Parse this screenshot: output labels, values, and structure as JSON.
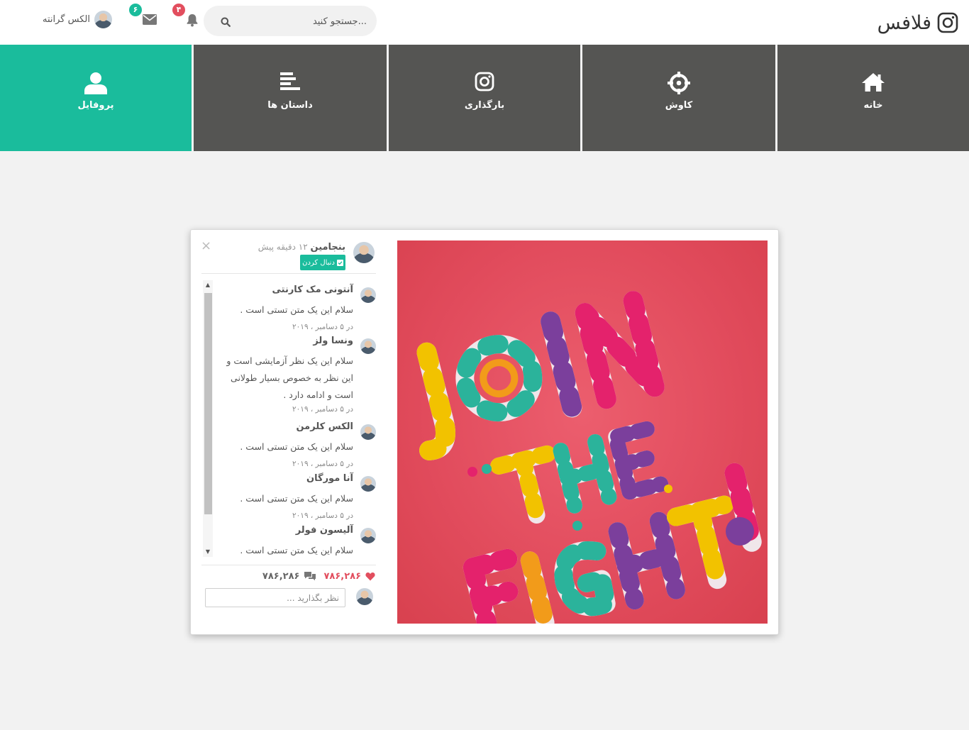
{
  "header": {
    "logo_text": "فلافس",
    "search_placeholder": "جستجو کنید...",
    "notifications_count": "۴",
    "messages_count": "۶",
    "user_name": "الکس گرانته"
  },
  "nav": {
    "tiles": [
      {
        "label": "خانه",
        "icon": "home-icon"
      },
      {
        "label": "کاوش",
        "icon": "crosshair-icon"
      },
      {
        "label": "بارگذاری",
        "icon": "instagram-icon"
      },
      {
        "label": "داستان ها",
        "icon": "align-left-icon"
      },
      {
        "label": "پروفایل",
        "icon": "user-icon"
      }
    ],
    "active": "پروفایل"
  },
  "post": {
    "author": "بنجامین",
    "time": "۱۲ دقیقه پیش",
    "follow_label": "دنبال کردن",
    "close": "×",
    "image_text": [
      "JOIN",
      "THE",
      "FIGHT!"
    ],
    "likes": "۷۸۶,۲۸۶",
    "comments_count": "۷۸۶,۲۸۶",
    "comment_placeholder": "نظر بگذارید ...",
    "comments": [
      {
        "name": "آنتونی مک کارنتی",
        "text": "سلام این یک متن تستی است .",
        "date": "در ۵ دسامبر ، ۲۰۱۹"
      },
      {
        "name": "ونسا ولز",
        "text": "سلام این یک نظر آزمایشی است و این نظر به خصوص بسیار طولانی است و ادامه دارد .",
        "date": "در ۵ دسامبر ، ۲۰۱۹"
      },
      {
        "name": "الکس کلرمن",
        "text": "سلام این یک متن تستی است .",
        "date": "در ۵ دسامبر ، ۲۰۱۹"
      },
      {
        "name": "آنا مورگان",
        "text": "سلام این یک متن تستی است .",
        "date": "در ۵ دسامبر ، ۲۰۱۹"
      },
      {
        "name": "آلیسون فولر",
        "text": "سلام این یک متن تستی است .",
        "date": ""
      }
    ]
  },
  "colors": {
    "accent": "#1abc9c",
    "tile": "#555553",
    "badge_red": "#e24e5e",
    "like": "#e24e5e",
    "poster_bg": "#e14b5c"
  }
}
